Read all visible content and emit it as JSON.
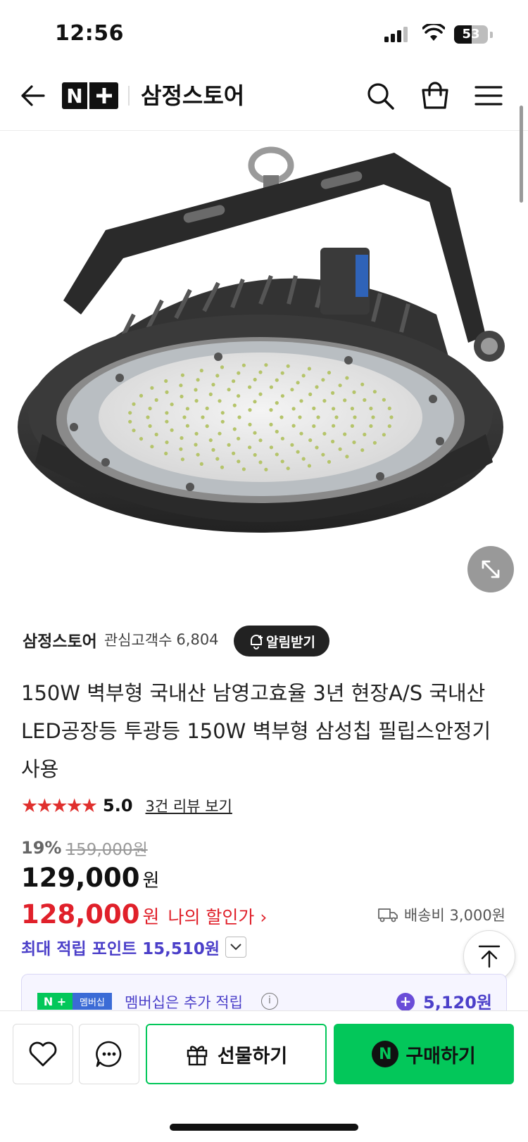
{
  "status_bar": {
    "time": "12:56",
    "battery": "53",
    "battery_level": 0.53
  },
  "header": {
    "logo_text": "N",
    "store_name": "삼정스토어"
  },
  "seller": {
    "name": "삼정스토어",
    "fans_label": "관심고객수",
    "fans_count": "6,804",
    "alert_button": "알림받기"
  },
  "product": {
    "title": "150W 벽부형 국내산 남영고효율 3년 현장A/S 국내산 LED공장등 투광등 150W 벽부형 삼성칩 필립스안정기 사용",
    "stars": "★★★★★",
    "rating": "5.0",
    "review_link": "3건 리뷰 보기",
    "discount_pct": "19%",
    "original_price": "159,000원",
    "price": "129,000",
    "price_unit": "원",
    "my_discount_price": "128,000",
    "my_discount_unit": "원",
    "my_discount_label": "나의 할인가 ›",
    "shipping": "배송비 3,000원",
    "points_text": "최대 적립 포인트 15,510원"
  },
  "membership": {
    "badge_n": "N +",
    "badge_label": "멤버십",
    "text": "멤버십은 추가 적립",
    "info": "i",
    "plus": "+",
    "points": "5,120원"
  },
  "bottom_bar": {
    "gift_label": "선물하기",
    "buy_n": "N",
    "buy_label": "구매하기"
  },
  "colors": {
    "brand_green": "#03c75a",
    "price_red": "#e0202a",
    "points_purple": "#4b3fc9"
  }
}
